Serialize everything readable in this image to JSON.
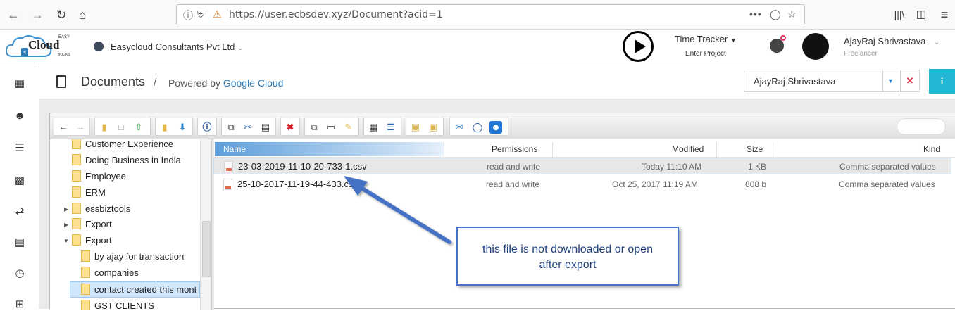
{
  "browser": {
    "url": "https://user.ecbsdev.xyz/Document?acid=1"
  },
  "header": {
    "logo_text": "Cloud",
    "logo_small": "EASY",
    "logo_sub": "BOOKS",
    "company": "Easycloud Consultants Pvt Ltd",
    "time_tracker": "Time Tracker",
    "enter_project": "Enter Project",
    "user_name": "AjayRaj Shrivastava",
    "user_role": "Freelancer"
  },
  "page": {
    "title": "Documents",
    "separator": "/",
    "powered_by": "Powered by",
    "powered_link": "Google Cloud",
    "selected_user": "AjayRaj Shrivastava"
  },
  "tree": {
    "items": [
      {
        "label": "Customer Experience"
      },
      {
        "label": "Doing Business in India"
      },
      {
        "label": "Employee"
      },
      {
        "label": "ERM"
      },
      {
        "label": "essbiztools"
      },
      {
        "label": "Export"
      },
      {
        "label": "Export"
      },
      {
        "label": "by ajay for transaction"
      },
      {
        "label": "companies"
      },
      {
        "label": "contact created this mont"
      },
      {
        "label": "GST CLIENTS"
      }
    ]
  },
  "columns": {
    "name": "Name",
    "permissions": "Permissions",
    "modified": "Modified",
    "size": "Size",
    "kind": "Kind"
  },
  "files": [
    {
      "name": "23-03-2019-11-10-20-733-1.csv",
      "permissions": "read and write",
      "modified": "Today 11:10 AM",
      "size": "1 KB",
      "kind": "Comma separated values"
    },
    {
      "name": "25-10-2017-11-19-44-433.csv",
      "permissions": "read and write",
      "modified": "Oct 25, 2017 11:19 AM",
      "size": "808 b",
      "kind": "Comma separated values"
    }
  ],
  "annotation": {
    "line1": "this file is not downloaded or open",
    "line2": "after export"
  },
  "colors": {
    "accent": "#23b7d5",
    "link": "#2a7ab8",
    "callout_border": "#4472c4"
  }
}
